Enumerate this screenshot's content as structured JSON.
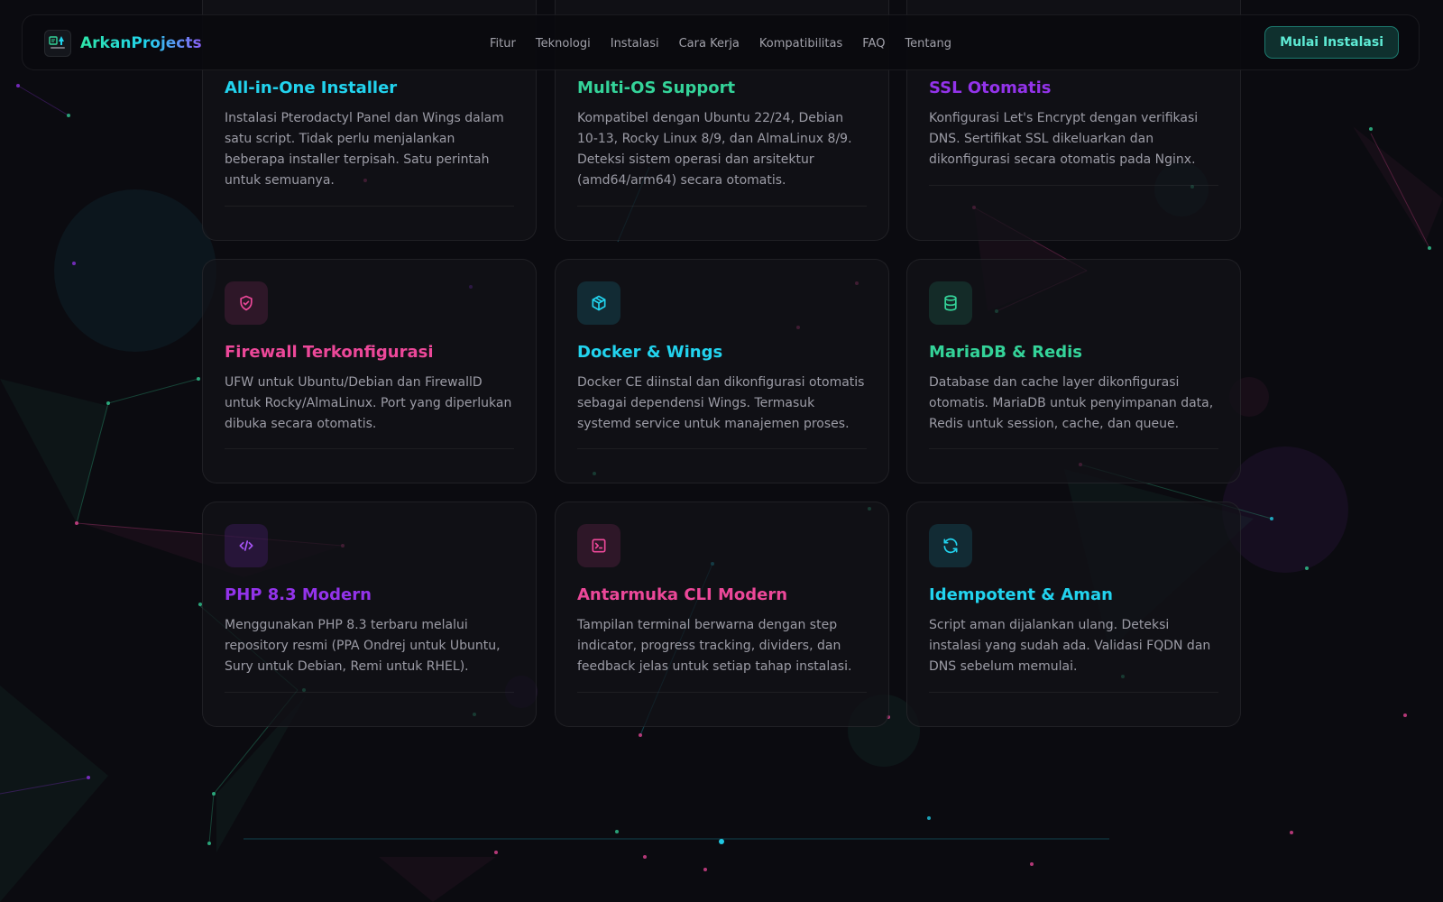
{
  "brand": {
    "name": "ArkanProjects"
  },
  "nav": {
    "links": [
      "Fitur",
      "Teknologi",
      "Instalasi",
      "Cara Kerja",
      "Kompatibilitas",
      "FAQ",
      "Tentang"
    ],
    "cta": "Mulai Instalasi"
  },
  "colors": {
    "cyan": "#22d3ee",
    "green": "#34d399",
    "purple": "#9333ea",
    "pink": "#ec4899",
    "bg": "#0b0b10"
  },
  "features": [
    {
      "title": "All-in-One Installer",
      "desc": "Instalasi Pterodactyl Panel dan Wings dalam satu script. Tidak perlu menjalankan beberapa installer terpisah. Satu perintah untuk semuanya.",
      "color": "cyan"
    },
    {
      "title": "Multi-OS Support",
      "desc": "Kompatibel dengan Ubuntu 22/24, Debian 10-13, Rocky Linux 8/9, dan AlmaLinux 8/9. Deteksi sistem operasi dan arsitektur (amd64/arm64) secara otomatis.",
      "color": "green"
    },
    {
      "title": "SSL Otomatis",
      "desc": "Konfigurasi Let's Encrypt dengan verifikasi DNS. Sertifikat SSL dikeluarkan dan dikonfigurasi secara otomatis pada Nginx.",
      "color": "purple"
    },
    {
      "title": "Firewall Terkonfigurasi",
      "desc": "UFW untuk Ubuntu/Debian dan FirewallD untuk Rocky/AlmaLinux. Port yang diperlukan dibuka secara otomatis.",
      "color": "pink",
      "icon": "shield-icon"
    },
    {
      "title": "Docker & Wings",
      "desc": "Docker CE diinstal dan dikonfigurasi otomatis sebagai dependensi Wings. Termasuk systemd service untuk manajemen proses.",
      "color": "cyan",
      "icon": "box-icon"
    },
    {
      "title": "MariaDB & Redis",
      "desc": "Database dan cache layer dikonfigurasi otomatis. MariaDB untuk penyimpanan data, Redis untuk session, cache, dan queue.",
      "color": "green",
      "icon": "database-icon"
    },
    {
      "title": "PHP 8.3 Modern",
      "desc": "Menggunakan PHP 8.3 terbaru melalui repository resmi (PPA Ondrej untuk Ubuntu, Sury untuk Debian, Remi untuk RHEL).",
      "color": "purple",
      "icon": "code-icon"
    },
    {
      "title": "Antarmuka CLI Modern",
      "desc": "Tampilan terminal berwarna dengan step indicator, progress tracking, dividers, dan feedback jelas untuk setiap tahap instalasi.",
      "color": "pink",
      "icon": "terminal-icon"
    },
    {
      "title": "Idempotent & Aman",
      "desc": "Script aman dijalankan ulang. Deteksi instalasi yang sudah ada. Validasi FQDN dan DNS sebelum memulai.",
      "color": "cyan",
      "icon": "refresh-icon"
    }
  ]
}
